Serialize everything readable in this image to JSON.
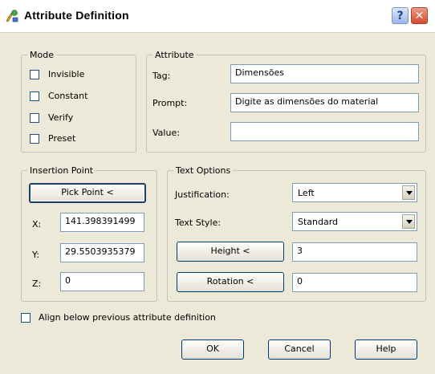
{
  "window": {
    "title": "Attribute Definition",
    "help_glyph": "?",
    "close_glyph": "✕"
  },
  "mode": {
    "legend": "Mode",
    "items": [
      {
        "label": "Invisible",
        "checked": false
      },
      {
        "label": "Constant",
        "checked": false
      },
      {
        "label": "Verify",
        "checked": false
      },
      {
        "label": "Preset",
        "checked": false
      }
    ]
  },
  "attribute": {
    "legend": "Attribute",
    "tag_label": "Tag:",
    "tag_value": "Dimensões",
    "prompt_label": "Prompt:",
    "prompt_value": "Digite as dimensões do material",
    "value_label": "Value:",
    "value_value": ""
  },
  "insertion": {
    "legend": "Insertion Point",
    "pick_label": "Pick Point <",
    "x_label": "X:",
    "x_value": "141.398391499",
    "y_label": "Y:",
    "y_value": "29.5503935379",
    "z_label": "Z:",
    "z_value": "0"
  },
  "text_options": {
    "legend": "Text Options",
    "justification_label": "Justification:",
    "justification_value": "Left",
    "style_label": "Text Style:",
    "style_value": "Standard",
    "height_button": "Height <",
    "height_value": "3",
    "rotation_button": "Rotation <",
    "rotation_value": "0"
  },
  "align_label": "Align below previous attribute definition",
  "buttons": {
    "ok": "OK",
    "cancel": "Cancel",
    "help": "Help"
  }
}
